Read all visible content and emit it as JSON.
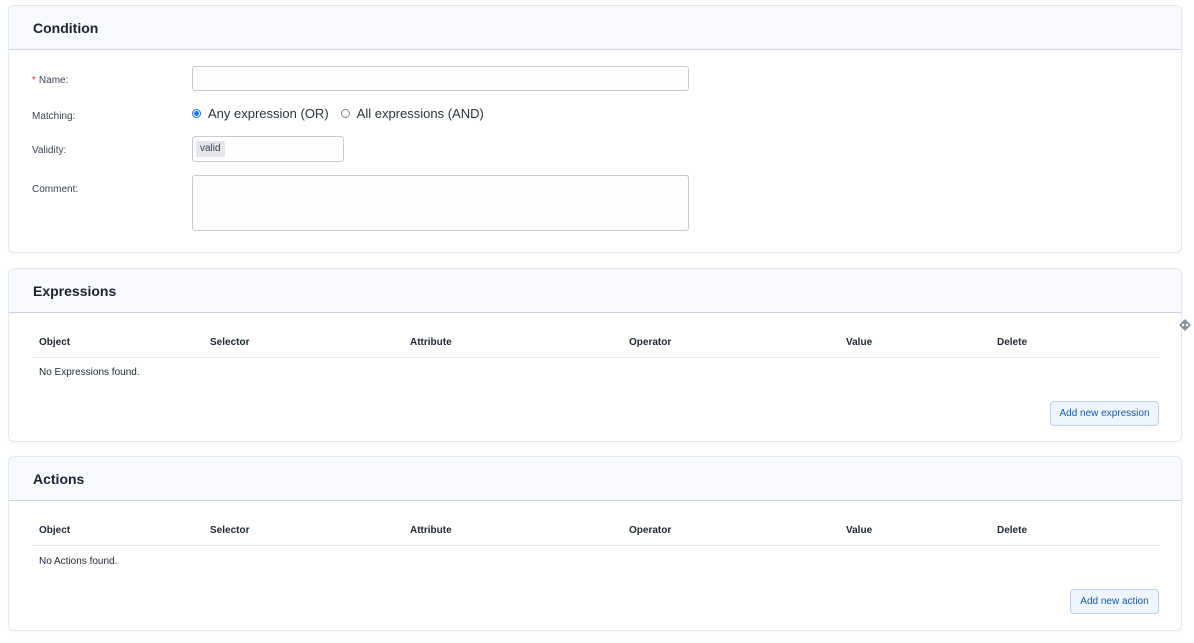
{
  "condition": {
    "title": "Condition",
    "name_label": "Name:",
    "required_mark": "*",
    "name_value": "",
    "matching_label": "Matching:",
    "matching_options": [
      "Any expression (OR)",
      "All expressions (AND)"
    ],
    "matching_selected": "Any expression (OR)",
    "validity_label": "Validity:",
    "validity_tag": "valid",
    "comment_label": "Comment:",
    "comment_value": ""
  },
  "expressions": {
    "title": "Expressions",
    "columns": [
      "Object",
      "Selector",
      "Attribute",
      "Operator",
      "Value",
      "Delete"
    ],
    "empty_message": "No Expressions found.",
    "add_button": "Add new expression"
  },
  "actions": {
    "title": "Actions",
    "columns": [
      "Object",
      "Selector",
      "Attribute",
      "Operator",
      "Value",
      "Delete"
    ],
    "empty_message": "No Actions found.",
    "add_button": "Add new action"
  },
  "colors": {
    "accent": "#1a73e8",
    "button_text": "#1559a8",
    "button_bg": "#eef5fd",
    "required": "#e03131",
    "header_bg": "#f7f9fc"
  },
  "icons": {
    "drag_handle": "drag-handle-icon"
  }
}
